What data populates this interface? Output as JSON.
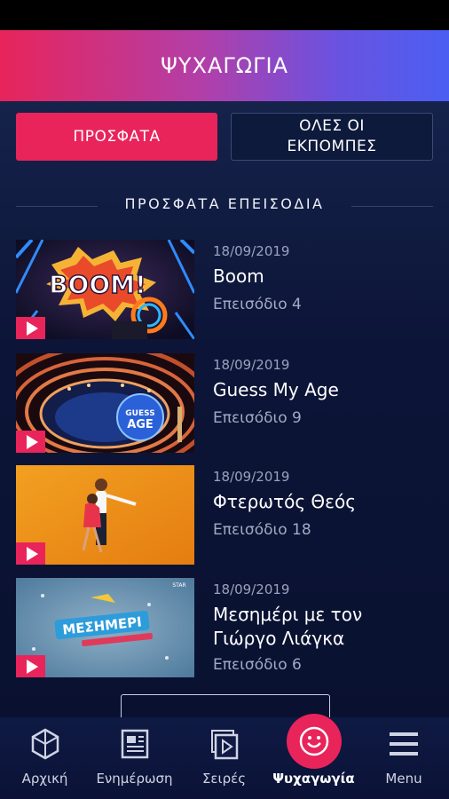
{
  "header": {
    "title": "ΨΥΧΑΓΩΓΙΑ"
  },
  "segments": {
    "recent_label": "ΠΡΟΣΦΑΤΑ",
    "all_shows_line1": "ΟΛΕΣ ΟΙ",
    "all_shows_line2": "ΕΚΠΟΜΠΕΣ"
  },
  "section": {
    "title": "ΠΡΟΣΦΑΤΑ ΕΠΕΙΣΟΔΙΑ"
  },
  "episodes": [
    {
      "date": "18/09/2019",
      "title_line1": "Boom",
      "title_line2": "",
      "episode": "Επεισόδιο 4",
      "thumb_text": "BOOM!"
    },
    {
      "date": "18/09/2019",
      "title_line1": "Guess My Age",
      "title_line2": "",
      "episode": "Επεισόδιο 9",
      "thumb_text_1": "GUESS",
      "thumb_text_2": "AGE"
    },
    {
      "date": "18/09/2019",
      "title_line1": "Φτερωτός Θεός",
      "title_line2": "",
      "episode": "Επεισόδιο 18"
    },
    {
      "date": "18/09/2019",
      "title_line1": "Μεσημέρι με τον",
      "title_line2": "Γιώργο Λιάγκα",
      "episode": "Επεισόδιο 6",
      "thumb_text": "ΜΕΣΗΜΕΡΙ",
      "thumb_brand": "STAR"
    }
  ],
  "nav": [
    {
      "label": "Αρχική",
      "icon": "home-cube-icon"
    },
    {
      "label": "Ενημέρωση",
      "icon": "newspaper-icon"
    },
    {
      "label": "Σειρές",
      "icon": "series-play-icon"
    },
    {
      "label": "Ψυχαγωγία",
      "icon": "smiley-icon",
      "active": true
    },
    {
      "label": "Menu",
      "icon": "hamburger-menu-icon"
    }
  ],
  "colors": {
    "accent": "#e8245b",
    "header_gradient_start": "#e8245b",
    "header_gradient_end": "#4a5ff2",
    "background": "#0b1130"
  }
}
